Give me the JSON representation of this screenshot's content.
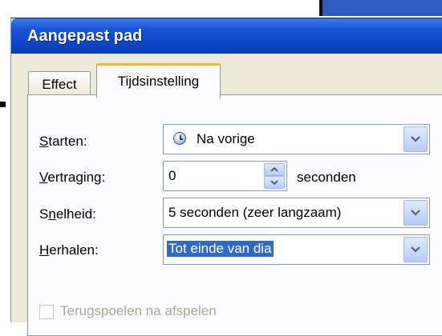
{
  "window": {
    "title": "Aangepast pad"
  },
  "tabs": [
    {
      "label": "Effect",
      "selected": false
    },
    {
      "label": "Tijdsinstelling",
      "selected": true
    }
  ],
  "form": {
    "start": {
      "label": "Starten:",
      "accel": "S",
      "rest": "tarten:",
      "value": "Na vorige",
      "icon": "clock-icon"
    },
    "delay": {
      "label": "Vertraging:",
      "accel": "V",
      "rest": "ertraging:",
      "value": "0",
      "unit": "seconden"
    },
    "speed": {
      "label": "Snelheid:",
      "accel_pre": "S",
      "accel": "n",
      "rest": "elheid:",
      "value": "5 seconden (zeer langzaam)"
    },
    "repeat": {
      "label": "Herhalen:",
      "accel": "H",
      "rest": "erhalen:",
      "value": "Tot einde van dia"
    },
    "rewind": {
      "label": "Terugspoelen na afspelen",
      "checked": false,
      "disabled": true
    }
  },
  "colors": {
    "titlebar": "#0b47c8",
    "selection": "#316ac5",
    "tab_highlight": "#f8b534",
    "dialog_bg": "#ece9d8"
  }
}
